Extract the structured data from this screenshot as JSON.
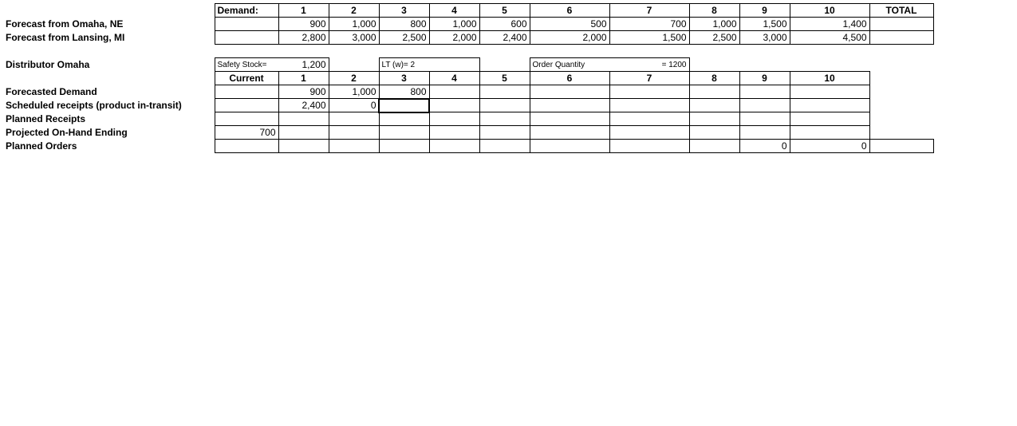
{
  "top": {
    "demand_label": "Demand:",
    "periods": [
      "1",
      "2",
      "3",
      "4",
      "5",
      "6",
      "7",
      "8",
      "9",
      "10"
    ],
    "total_label": "TOTAL",
    "rows": [
      {
        "label": "Forecast from Omaha, NE",
        "vals": [
          "900",
          "1,000",
          "800",
          "1,000",
          "600",
          "500",
          "700",
          "1,000",
          "1,500",
          "1,400"
        ]
      },
      {
        "label": "Forecast from Lansing, MI",
        "vals": [
          "2,800",
          "3,000",
          "2,500",
          "2,000",
          "2,400",
          "2,000",
          "1,500",
          "2,500",
          "3,000",
          "4,500"
        ]
      }
    ]
  },
  "mid": {
    "title": "Distributor Omaha",
    "ss_label": "Safety Stock=",
    "ss_value": "1,200",
    "lt_label": "LT (w)= 2",
    "oq_label": "Order Quantity",
    "oq_value": "= 1200",
    "current_label": "Current",
    "periods": [
      "1",
      "2",
      "3",
      "4",
      "5",
      "6",
      "7",
      "8",
      "9",
      "10"
    ],
    "rows": [
      {
        "label": "Forecasted Demand",
        "current": "",
        "vals": [
          "900",
          "1,000",
          "800",
          "",
          "",
          "",
          "",
          "",
          "",
          ""
        ]
      },
      {
        "label": "Scheduled receipts (product in-transit)",
        "current": "",
        "vals": [
          "2,400",
          "0",
          "",
          "",
          "",
          "",
          "",
          "",
          "",
          ""
        ]
      },
      {
        "label": "Planned Receipts",
        "current": "",
        "vals": [
          "",
          "",
          "",
          "",
          "",
          "",
          "",
          "",
          "",
          ""
        ]
      },
      {
        "label": "Projected On-Hand Ending",
        "current": "700",
        "vals": [
          "",
          "",
          "",
          "",
          "",
          "",
          "",
          "",
          "",
          ""
        ]
      },
      {
        "label": "Planned Orders",
        "current": "",
        "vals": [
          "",
          "",
          "",
          "",
          "",
          "",
          "",
          "",
          "0",
          "0"
        ]
      }
    ]
  }
}
